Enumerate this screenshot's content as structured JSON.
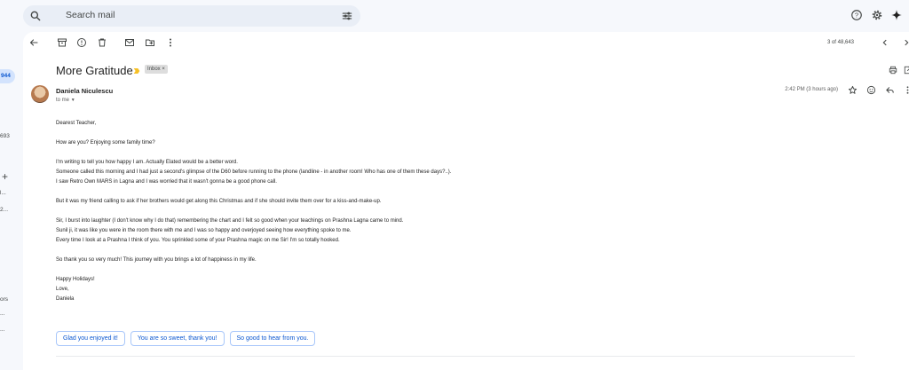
{
  "search": {
    "placeholder": "Search mail"
  },
  "rail": {
    "inbox_count": "944",
    "frag_1": "693",
    "frag_2": "l...",
    "frag_3": "2...",
    "frag_4": "ors",
    "frag_5": "...",
    "frag_6": "..."
  },
  "toolbar": {
    "pager": "3 of 48,643"
  },
  "email": {
    "subject": "More Gratitude",
    "label": "Inbox",
    "sender": "Daniela Niculescu",
    "to": "to me",
    "time": "2:42 PM (3 hours ago)",
    "body": [
      "Dearest Teacher,",
      "",
      "How are you? Enjoying some family time?",
      "",
      "I'm writing to tell you how happy I am. Actually Elated would be a better word.",
      "Someone called this morning and I had just a second's glimpse of the D60 before running to the phone (landline - in another room! Who has one of them these days?..).",
      "I saw Retro Own MARS in Lagna and I was worried that it wasn't gonna be a good phone call.",
      "",
      "But it was my friend calling to ask if her brothers would get along this Christmas and if she should invite them over for a kiss-and-make-up.",
      "",
      "Sir, I burst into laughter (I don't know why I do that) remembering the chart and I felt so good when your teachings on Prashna Lagna came to mind.",
      "Sunil ji, it was like you were in the room there with me and I was so happy and overjoyed seeing how everything spoke to me.",
      "Every time I look at a Prashna I think of you. You sprinkled some of your Prashna magic on me Sir! I'm so totally hooked.",
      "",
      "So thank you so very much! This journey with you brings a lot of happiness in my life.",
      "",
      "Happy Holidays!",
      "Love,",
      "Daniela"
    ]
  },
  "smart_replies": [
    "Glad you enjoyed it!",
    "You are so sweet, thank you!",
    "So good to hear from you."
  ],
  "colors": {
    "accent": "#0b57d0",
    "chip_border": "#a8c7fa",
    "background": "#f6f8fc",
    "important": "#f6c026"
  }
}
